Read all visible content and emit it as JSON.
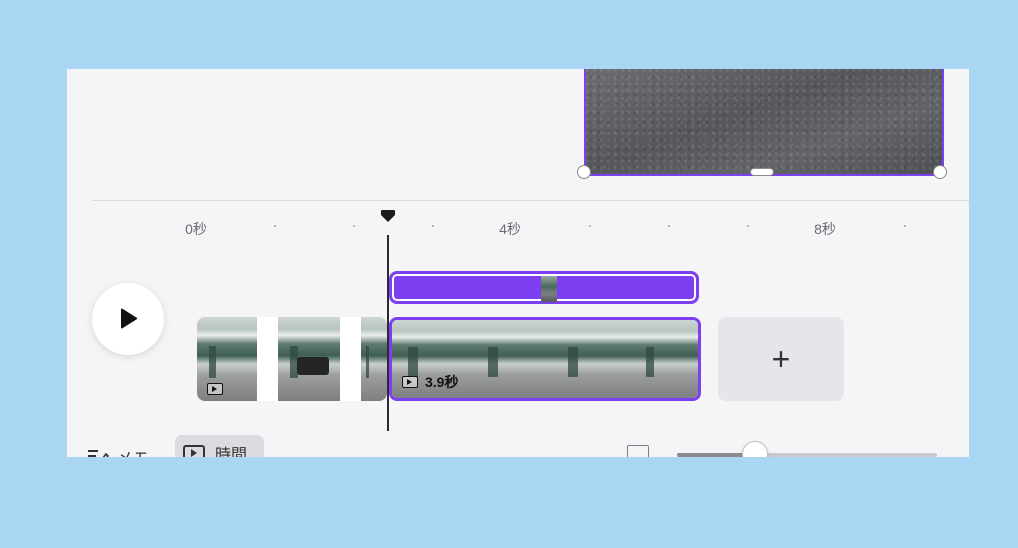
{
  "timeline": {
    "ruler": {
      "labels": [
        "0秒",
        "4秒",
        "8秒"
      ]
    },
    "clips": [
      {
        "type": "video",
        "duration_label": ""
      },
      {
        "type": "video",
        "duration_label": "3.9秒",
        "selected": true
      }
    ],
    "add_clip_label": "+",
    "accent_color": "#7d3ff2"
  },
  "playback": {
    "play_icon": "play-icon"
  },
  "bottom_toolbar": {
    "notes_label": "メモ",
    "time_label": "時間",
    "zoom_level": 0.3
  }
}
